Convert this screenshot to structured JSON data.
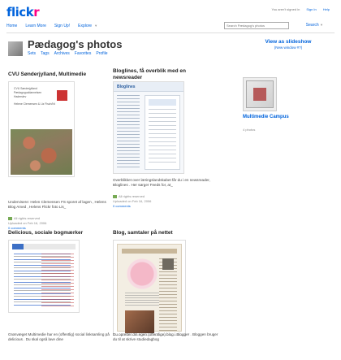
{
  "logo": {
    "part1": "flick",
    "part2": "r"
  },
  "top": {
    "signed_out": "You aren't signed in",
    "sign_in": "Sign In",
    "help": "Help"
  },
  "nav": {
    "items": [
      "Home",
      "Learn More",
      "Sign Up!",
      "Explore"
    ],
    "search_placeholder": "Search Pædagog's photos",
    "search_label": "Search"
  },
  "page": {
    "title": "Pædagog's photos",
    "subnav": [
      "Sets",
      "Tags",
      "Archives",
      "Favorites",
      "Profile"
    ]
  },
  "slideshow": {
    "label": "View as slideshow",
    "sub": "(New window #?)"
  },
  "set": {
    "title": "Multimedie Campus",
    "count": "4 photos"
  },
  "photos": [
    {
      "title": "CVU Sønderjylland, Multimedie",
      "doc_text": "CVU Sønderjylland\nPædagoguddannelsen\nHaderslev\n\nHelene Clemensen & Liz Fisch/Nt",
      "desc": "Underviserе: Helen Clemensen FS sporet af lagen , Helens Blog Amed , Helens Flickr foto Lis_",
      "license": "All rights reserved",
      "uploaded": "Uploaded on Feb 16, 2006",
      "comments": "0 comments"
    },
    {
      "title": "Bloglines, få overblik med en newsreader",
      "screen_logo": "Bloglines",
      "desc": "Overblikket over læringslandskabet får du i en newsreader, Bloglines . Her sørger Feeds for, at_",
      "license": "All rights reserved",
      "uploaded": "Uploaded on Feb 16, 2006",
      "comments": "0 comments"
    },
    {
      "title": "Delicious, sociale bogmærker",
      "desc": "Grønvæget Multimedie har en (offentlig) social linksamling på delicious . Du skal også lave dine",
      "license": "",
      "uploaded": "",
      "comments": ""
    },
    {
      "title": "Blog, samtaler på nettet",
      "desc": "Du opretter din egen (offentlige) blog i Blogger . Bloggen bruger du til at skrive studiedagbog",
      "license": "",
      "uploaded": "",
      "comments": ""
    }
  ]
}
